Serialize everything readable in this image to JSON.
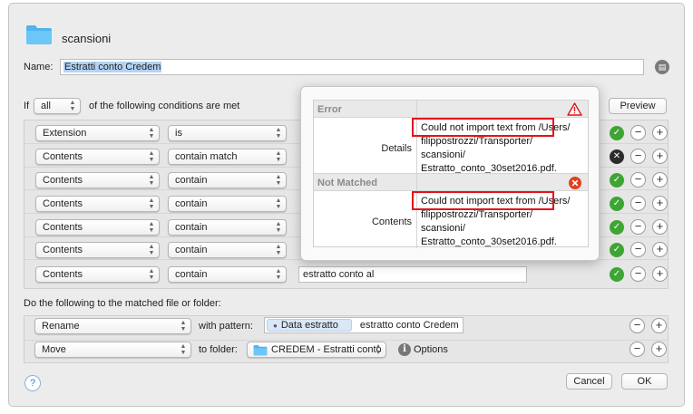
{
  "header": {
    "folder_name": "scansioni",
    "name_label": "Name:",
    "name_value": "Estratti conto Credem"
  },
  "conditions": {
    "if_label": "If",
    "match_mode": "all",
    "conditions_text": "of the following conditions are met",
    "preview_label": "Preview",
    "rows": [
      {
        "field": "Extension",
        "operator": "is",
        "value": ""
      },
      {
        "field": "Contents",
        "operator": "contain match",
        "value": ""
      },
      {
        "field": "Contents",
        "operator": "contain",
        "value": ""
      },
      {
        "field": "Contents",
        "operator": "contain",
        "value": ""
      },
      {
        "field": "Contents",
        "operator": "contain",
        "value": ""
      },
      {
        "field": "Contents",
        "operator": "contain",
        "value": ""
      },
      {
        "field": "Contents",
        "operator": "contain",
        "value": "estratto conto al"
      }
    ]
  },
  "actions": {
    "label": "Do the following to the matched file or folder:",
    "rename": {
      "action": "Rename",
      "with_pattern": "with pattern:",
      "token": "Data estratto",
      "pattern_text": "estratto conto Credem"
    },
    "move": {
      "action": "Move",
      "to_folder": "to folder:",
      "folder": "CREDEM - Estratti conto",
      "options_label": "Options"
    }
  },
  "footer": {
    "help": "?",
    "cancel_label": "Cancel",
    "ok_label": "OK"
  },
  "preview_popover": {
    "sections": [
      {
        "heading": "Error",
        "row_label": "Details",
        "message_lines": [
          "Could not import text from /Users/",
          "filippostrozzi/Transporter/",
          "scansioni/",
          "Estratto_conto_30set2016.pdf."
        ]
      },
      {
        "heading": "Not Matched",
        "row_label": "Contents",
        "message_lines": [
          "Could not import text from /Users/",
          "filippostrozzi/Transporter/",
          "scansioni/",
          "Estratto_conto_30set2016.pdf."
        ]
      }
    ]
  },
  "colors": {
    "accent_green": "#3ea534",
    "highlight_red": "#e3131b",
    "folder_blue": "#4fb4f0",
    "selection": "#b4d2f5"
  },
  "icons": {
    "folder": "folder-icon",
    "check": "checkmark-circle-icon",
    "warning": "warning-triangle-icon",
    "error": "error-x-circle-icon",
    "info": "info-icon",
    "help": "help-icon"
  }
}
